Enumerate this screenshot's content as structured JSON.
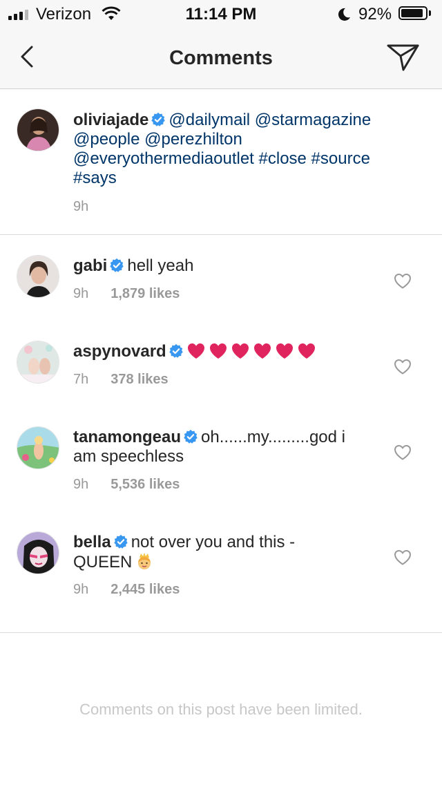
{
  "status_bar": {
    "carrier": "Verizon",
    "time": "11:14 PM",
    "battery_percent": "92%",
    "battery_level": 0.92
  },
  "nav": {
    "title": "Comments",
    "back_icon": "chevron-left-icon",
    "send_icon": "paper-plane-icon"
  },
  "caption": {
    "username": "oliviajade",
    "line1": "@dailymail @starmagazine",
    "line2": "@people @perezhilton",
    "line3a": "@everyothermediaoutlet",
    "line3b": "#close #source",
    "line4": "#says",
    "time": "9h"
  },
  "comments": [
    {
      "username": "gabi",
      "text": "hell yeah",
      "time": "9h",
      "likes": "1,879 likes"
    },
    {
      "username": "aspynovard",
      "text": "",
      "hearts": 6,
      "time": "7h",
      "likes": "378 likes"
    },
    {
      "username": "tanamongeau",
      "text_line1": "oh......my.........god i",
      "text_line2": "am speechless",
      "time": "9h",
      "likes": "5,536 likes"
    },
    {
      "username": "bella",
      "text_line1": "not over you and this -",
      "text_line2": "QUEEN",
      "time": "9h",
      "likes": "2,445 likes"
    }
  ],
  "footer": {
    "limited_text": "Comments on this post have been limited."
  },
  "colors": {
    "verified": "#3897f0",
    "mention": "#003569",
    "meta": "#999999",
    "heart_red": "#e0245e"
  }
}
